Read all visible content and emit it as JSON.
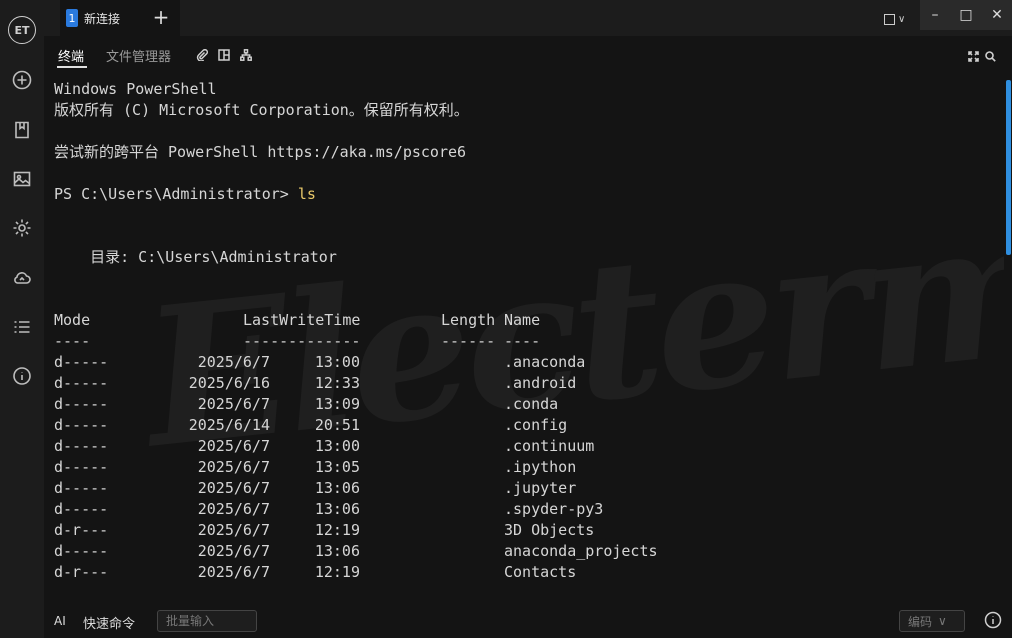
{
  "app": {
    "logo_text": "ET"
  },
  "tabbar": {
    "tabs": [
      {
        "number": "1",
        "title": "新连接"
      }
    ],
    "add_tab_label": "+",
    "window_controls": {
      "minimize": "–",
      "maximize": "□",
      "close": "✕"
    }
  },
  "subtabs": [
    {
      "label": "终端",
      "active": true
    },
    {
      "label": "文件管理器",
      "active": false
    }
  ],
  "terminal": {
    "banner": [
      "Windows PowerShell",
      "版权所有 (C) Microsoft Corporation。保留所有权利。",
      "",
      "尝试新的跨平台 PowerShell https://aka.ms/pscore6"
    ],
    "prompt": "PS C:\\Users\\Administrator> ",
    "command": "ls",
    "directory_line": "    目录: C:\\Users\\Administrator",
    "headers": {
      "mode": "Mode",
      "lastwritetime": "LastWriteTime",
      "length": "Length",
      "name": "Name"
    },
    "separators": {
      "mode": "----",
      "lastwritetime": "-------------",
      "length": "------",
      "name": "----"
    },
    "rows": [
      {
        "mode": "d-----",
        "date": "2025/6/7",
        "time": "13:00",
        "name": ".anaconda"
      },
      {
        "mode": "d-----",
        "date": "2025/6/16",
        "time": "12:33",
        "name": ".android"
      },
      {
        "mode": "d-----",
        "date": "2025/6/7",
        "time": "13:09",
        "name": ".conda"
      },
      {
        "mode": "d-----",
        "date": "2025/6/14",
        "time": "20:51",
        "name": ".config"
      },
      {
        "mode": "d-----",
        "date": "2025/6/7",
        "time": "13:00",
        "name": ".continuum"
      },
      {
        "mode": "d-----",
        "date": "2025/6/7",
        "time": "13:05",
        "name": ".ipython"
      },
      {
        "mode": "d-----",
        "date": "2025/6/7",
        "time": "13:06",
        "name": ".jupyter"
      },
      {
        "mode": "d-----",
        "date": "2025/6/7",
        "time": "13:06",
        "name": ".spyder-py3"
      },
      {
        "mode": "d-r---",
        "date": "2025/6/7",
        "time": "12:19",
        "name": "3D Objects"
      },
      {
        "mode": "d-----",
        "date": "2025/6/7",
        "time": "13:06",
        "name": "anaconda_projects"
      },
      {
        "mode": "d-r---",
        "date": "2025/6/7",
        "time": "12:19",
        "name": "Contacts"
      }
    ],
    "watermark": "Electerm"
  },
  "bottombar": {
    "ai_label": "AI",
    "quick_command_label": "快速命令",
    "batch_input_placeholder": "批量输入",
    "encoding_label": "编码",
    "encoding_chevron": "∨"
  },
  "colors": {
    "accent": "#2f8fe0",
    "command": "#e8c86a",
    "online": "#2ecc71"
  }
}
